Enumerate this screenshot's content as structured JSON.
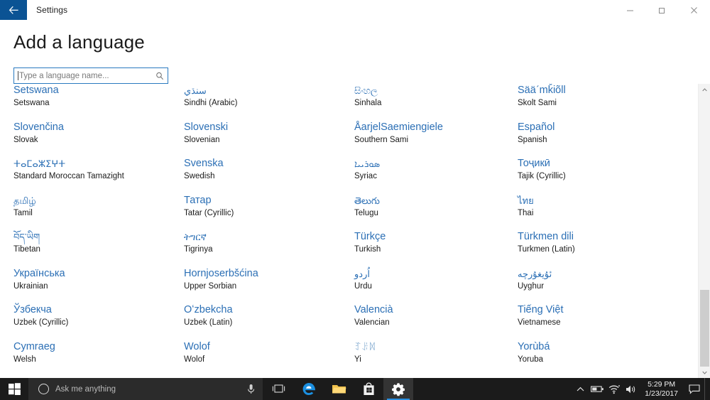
{
  "window": {
    "title": "Settings",
    "back_icon": "back-arrow-icon",
    "minimize_icon": "minimize-icon",
    "maximize_icon": "maximize-restore-icon",
    "close_icon": "close-icon",
    "accent_color": "#0b5394"
  },
  "page": {
    "heading": "Add a language",
    "link_color": "#2b6fb5"
  },
  "search": {
    "value": "",
    "placeholder": "Type a language name...",
    "icon": "search-icon",
    "border_color": "#2a7ac0"
  },
  "languages": [
    {
      "native": "Setswana",
      "english": "Setswana",
      "col": 1
    },
    {
      "native": "Slovenčina",
      "english": "Slovak",
      "col": 1
    },
    {
      "native": "ⵜⴰⵎⴰⵣⵉⵖⵜ",
      "english": "Standard Moroccan Tamazight",
      "col": 1,
      "script": true
    },
    {
      "native": "தமிழ்",
      "english": "Tamil",
      "col": 1,
      "script": true
    },
    {
      "native": "བོད་ཡིག",
      "english": "Tibetan",
      "col": 1,
      "script": true
    },
    {
      "native": "Українська",
      "english": "Ukrainian",
      "col": 1
    },
    {
      "native": "Ўзбекча",
      "english": "Uzbek (Cyrillic)",
      "col": 1
    },
    {
      "native": "Cymraeg",
      "english": "Welsh",
      "col": 1
    },
    {
      "native": "سنڌي",
      "english": "Sindhi (Arabic)",
      "col": 2,
      "script": true
    },
    {
      "native": "Slovenski",
      "english": "Slovenian",
      "col": 2
    },
    {
      "native": "Svenska",
      "english": "Swedish",
      "col": 2
    },
    {
      "native": "Татар",
      "english": "Tatar (Cyrillic)",
      "col": 2
    },
    {
      "native": "ትግርኛ",
      "english": "Tigrinya",
      "col": 2,
      "script": true
    },
    {
      "native": "Hornjoserbšćina",
      "english": "Upper Sorbian",
      "col": 2
    },
    {
      "native": "Oʻzbekcha",
      "english": "Uzbek (Latin)",
      "col": 2
    },
    {
      "native": "Wolof",
      "english": "Wolof",
      "col": 2
    },
    {
      "native": "සිංහල",
      "english": "Sinhala",
      "col": 3,
      "script": true
    },
    {
      "native": "ÅarjelSaemiengiele",
      "english": "Southern Sami",
      "col": 3
    },
    {
      "native": "ܣܘܪܝܝܐ",
      "english": "Syriac",
      "col": 3,
      "script": true
    },
    {
      "native": "తెలుగు",
      "english": "Telugu",
      "col": 3,
      "script": true
    },
    {
      "native": "Türkçe",
      "english": "Turkish",
      "col": 3
    },
    {
      "native": "اُردو",
      "english": "Urdu",
      "col": 3,
      "script": true
    },
    {
      "native": "Valencià",
      "english": "Valencian",
      "col": 3
    },
    {
      "native": "ꆈꌠꉙ",
      "english": "Yi",
      "col": 3,
      "script": true,
      "faint": true
    },
    {
      "native": "Sääˊmǩiõll",
      "english": "Skolt Sami",
      "col": 4
    },
    {
      "native": "Español",
      "english": "Spanish",
      "col": 4
    },
    {
      "native": "Тоҷикӣ",
      "english": "Tajik (Cyrillic)",
      "col": 4
    },
    {
      "native": "ไทย",
      "english": "Thai",
      "col": 4,
      "script": true
    },
    {
      "native": "Türkmen dili",
      "english": "Turkmen (Latin)",
      "col": 4
    },
    {
      "native": "ئۇيغۇرچە",
      "english": "Uyghur",
      "col": 4,
      "script": true
    },
    {
      "native": "Tiếng Việt",
      "english": "Vietnamese",
      "col": 4
    },
    {
      "native": "Yorùbá",
      "english": "Yoruba",
      "col": 4
    }
  ],
  "scrollbar": {
    "up_arrow_icon": "chevron-up-icon",
    "down_arrow_icon": "chevron-down-icon"
  },
  "taskbar": {
    "start_icon": "windows-start-icon",
    "cortana_placeholder": "Ask me anything",
    "cortana_circle_icon": "cortana-circle-icon",
    "mic_icon": "microphone-icon",
    "taskview_icon": "task-view-icon",
    "edge_icon": "edge-browser-icon",
    "explorer_icon": "file-explorer-icon",
    "store_icon": "microsoft-store-icon",
    "settings_icon": "settings-gear-icon",
    "tray": {
      "overflow_icon": "show-hidden-icons-chevron",
      "battery_icon": "battery-icon",
      "wifi_icon": "wifi-icon",
      "volume_icon": "volume-icon",
      "time": "5:29 PM",
      "date": "1/23/2017",
      "action_center_icon": "action-center-icon"
    }
  }
}
